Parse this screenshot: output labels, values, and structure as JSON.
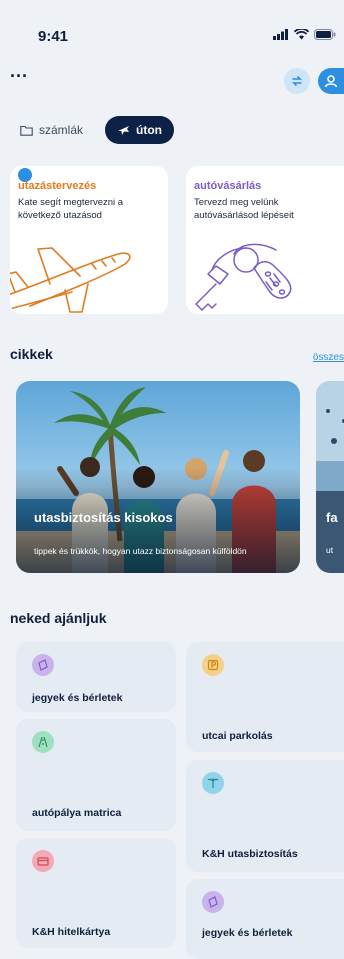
{
  "status_bar": {
    "time": "9:41"
  },
  "header": {
    "more": "..."
  },
  "tabs": [
    {
      "label": "számlák"
    },
    {
      "label": "úton"
    }
  ],
  "feature_cards": [
    {
      "title": "utazástervezés",
      "description": "Kate segít megtervezni a következő utazásod",
      "color": "#e07b1f"
    },
    {
      "title": "autóvásárlás",
      "description": "Tervezd meg velünk autóvásárlásod lépéseit",
      "color": "#7b5cc8"
    }
  ],
  "articles": {
    "title": "cikkek",
    "see_all": "összes",
    "items": [
      {
        "title": "utasbiztosítás kisokos",
        "description": "tippek és trükkök, hogyan utazz biztonságosan külföldön"
      },
      {
        "title": "fa",
        "description": "ut"
      }
    ]
  },
  "recommended": {
    "title": "neked ajánljuk",
    "items": [
      {
        "label": "jegyek és bérletek",
        "icon": "ticket-icon",
        "color": "#c9b3ea"
      },
      {
        "label": "utcai parkolás",
        "icon": "parking-icon",
        "color": "#f5d08a"
      },
      {
        "label": "autópálya matrica",
        "icon": "highway-icon",
        "color": "#9ee0c0"
      },
      {
        "label": "K&H utasbiztosítás",
        "icon": "palm-icon",
        "color": "#8fd4e8"
      },
      {
        "label": "K&H hitelkártya",
        "icon": "card-icon",
        "color": "#f4a9b4"
      },
      {
        "label": "jegyek és bérletek",
        "icon": "ticket-icon",
        "color": "#c9b3ea"
      }
    ]
  }
}
